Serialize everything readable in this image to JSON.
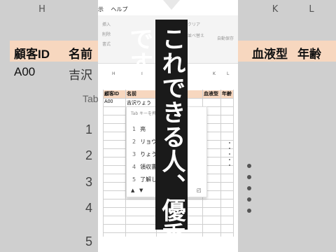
{
  "background": {
    "col_headers": [
      "H",
      "I",
      "J",
      "K",
      "L"
    ],
    "headers": [
      "顧客ID",
      "名前",
      "血液型",
      "年齢"
    ],
    "row1_id": "A00",
    "row1_name": "吉沢",
    "tab_hint": "Tab",
    "numbers": [
      "1",
      "2",
      "3",
      "4",
      "5"
    ]
  },
  "app": {
    "menu": [
      "示",
      "ヘルプ"
    ],
    "ribbon_labels": [
      "挿入",
      "削除",
      "書式",
      "クリア",
      "並べ替え",
      "自動保存"
    ]
  },
  "sheet": {
    "col_headers": [
      "H",
      "I",
      "J",
      "K",
      "L"
    ],
    "headers": [
      "顧客ID",
      "名前",
      "",
      "血液型",
      "年齢"
    ],
    "row1": {
      "id": "A00",
      "name": "吉沢りょう"
    }
  },
  "ime": {
    "hint": "Tab キーを押して選択します",
    "candidates": [
      {
        "n": "1",
        "text": "亮"
      },
      {
        "n": "2",
        "text": "リョウ"
      },
      {
        "n": "3",
        "text": "りょう"
      },
      {
        "n": "4",
        "text": "領収書"
      },
      {
        "n": "5",
        "text": "了解しま"
      }
    ]
  },
  "overlay": {
    "caption": "これできる人、優秀です。"
  }
}
